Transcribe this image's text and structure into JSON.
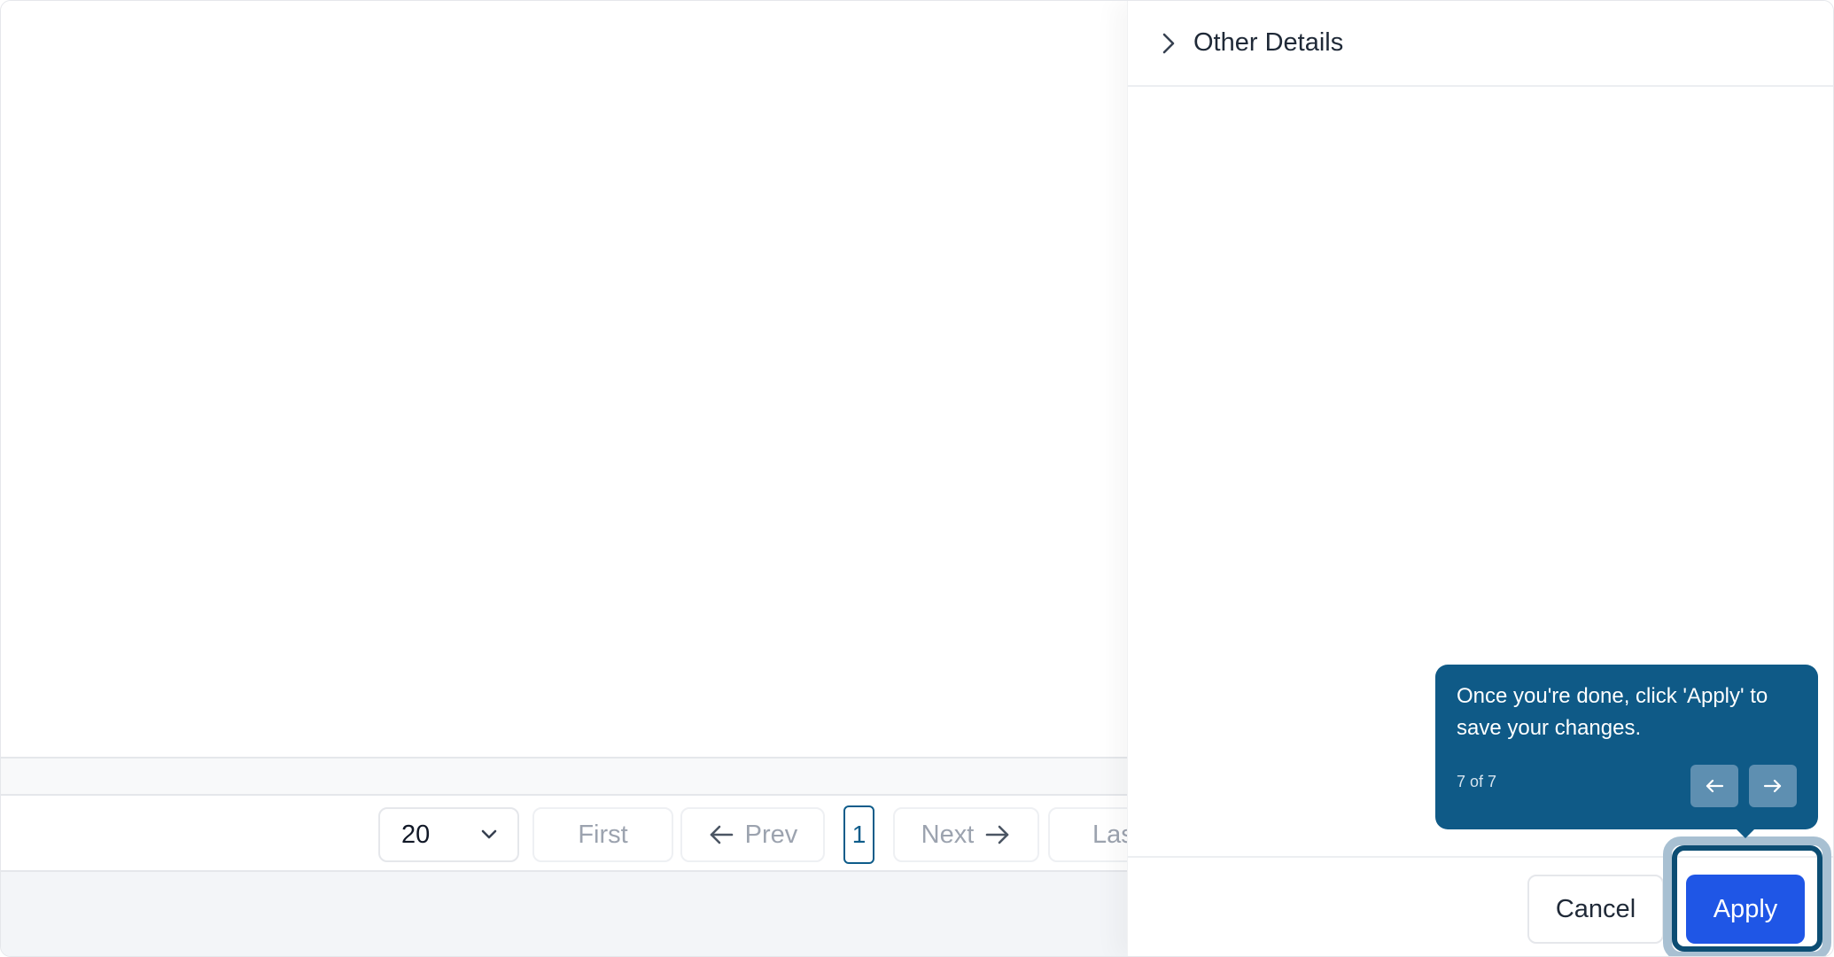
{
  "pagination": {
    "page_size": "20",
    "first_label": "First",
    "prev_label": "Prev",
    "current_page": "1",
    "next_label": "Next",
    "last_label": "Las"
  },
  "drawer": {
    "section_title": "Other Details",
    "cancel_label": "Cancel",
    "apply_label": "Apply"
  },
  "tour": {
    "message": "Once you're done, click 'Apply' to save your changes.",
    "progress": "7 of 7"
  },
  "icons": {
    "page_size_dropdown": "chevron-down-icon",
    "prev": "arrow-left-icon",
    "next": "arrow-right-icon",
    "section_toggle": "chevron-right-icon",
    "tour_prev": "arrow-left-icon",
    "tour_next": "arrow-right-icon"
  },
  "colors": {
    "primary": "#1f56e6",
    "tooltip_bg": "#0f5a87",
    "highlight_ring": "#0c4d73",
    "current_page_border": "#0e5c8a"
  }
}
